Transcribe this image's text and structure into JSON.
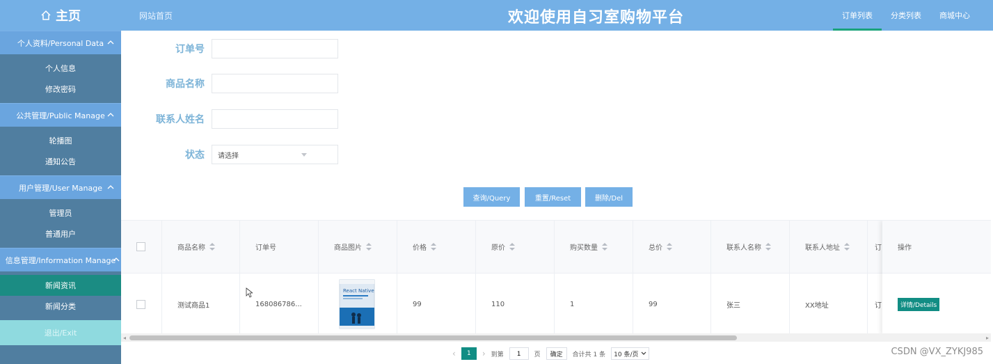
{
  "header": {
    "brand": "主页",
    "site_home": "网站首页",
    "site_title": "欢迎使用自习室购物平台",
    "nav": [
      {
        "label": "订单列表",
        "active": true
      },
      {
        "label": "分类列表",
        "active": false
      },
      {
        "label": "商城中心",
        "active": false
      }
    ]
  },
  "sidebar": {
    "groups": [
      {
        "title": "个人资料/Personal Data",
        "items": [
          "个人信息",
          "修改密码"
        ]
      },
      {
        "title": "公共管理/Public Manage",
        "items": [
          "轮播图",
          "通知公告"
        ]
      },
      {
        "title": "用户管理/User Manage",
        "items": [
          "管理员",
          "普通用户"
        ]
      },
      {
        "title": "信息管理/Information Manage",
        "items": [
          "新闻资讯",
          "新闻分类"
        ]
      }
    ],
    "active_item": "新闻资讯",
    "exit": "退出/Exit"
  },
  "form": {
    "order_no_label": "订单号",
    "product_name_label": "商品名称",
    "contact_name_label": "联系人姓名",
    "status_label": "状态",
    "status_placeholder": "请选择",
    "order_no_value": "",
    "product_name_value": "",
    "contact_name_value": ""
  },
  "buttons": {
    "query": "查询/Query",
    "reset": "重置/Reset",
    "delete": "删除/Del"
  },
  "table": {
    "headers": [
      "商品名称",
      "订单号",
      "商品图片",
      "价格",
      "原价",
      "购买数量",
      "总价",
      "联系人名称",
      "联系人地址",
      "订"
    ],
    "action_header": "操作",
    "rows": [
      {
        "product_name": "测试商品1",
        "order_no": "168086786...",
        "price": "99",
        "original_price": "110",
        "quantity": "1",
        "total": "99",
        "contact_name": "张三",
        "contact_address": "XX地址",
        "cut_text": "订",
        "detail_button": "详情/Details",
        "image_title": "React Native"
      }
    ]
  },
  "pagination": {
    "current_page": "1",
    "goto_label": "到第",
    "goto_value": "1",
    "page_suffix": "页",
    "confirm": "确定",
    "total": "合计共 1 条",
    "page_size": "10 条/页"
  },
  "watermark": "CSDN @VX_ZYKJ985",
  "colors": {
    "header_bg": "#74b0e6",
    "sidebar_bg": "#507ea0",
    "active_teal": "#118d84"
  }
}
